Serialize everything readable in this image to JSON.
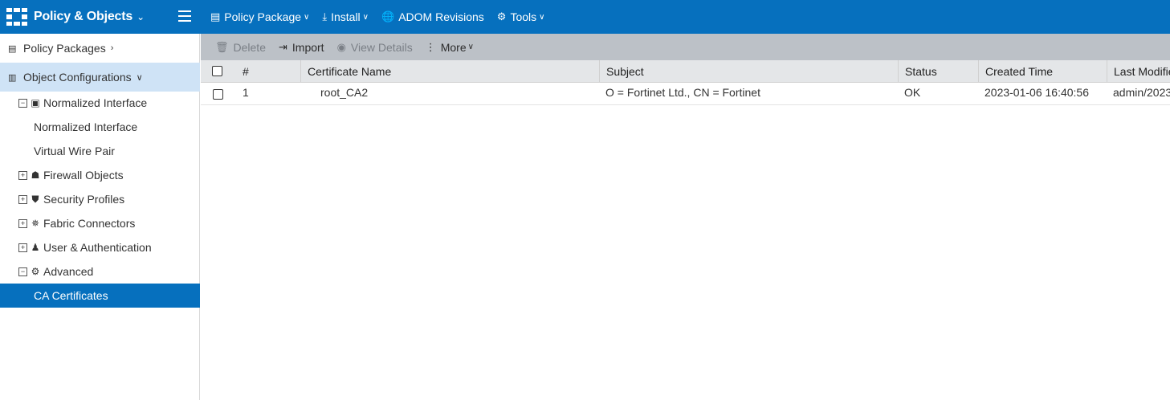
{
  "topbar": {
    "app_title": "Policy & Objects",
    "menu": [
      {
        "label": "Policy Package",
        "icon": "policy-package-icon"
      },
      {
        "label": "Install",
        "icon": "install-icon"
      },
      {
        "label": "ADOM Revisions",
        "icon": "globe-icon"
      },
      {
        "label": "Tools",
        "icon": "gear-icon"
      }
    ],
    "colors": {
      "accent": "#0670be"
    }
  },
  "sidebar": {
    "policy_packages": "Policy Packages",
    "object_configurations": "Object Configurations",
    "items": [
      {
        "label": "Normalized Interface",
        "icon": "interface-icon",
        "expander": "−"
      },
      {
        "label": "Normalized Interface"
      },
      {
        "label": "Virtual Wire Pair"
      },
      {
        "label": "Firewall Objects",
        "icon": "firewall-icon",
        "expander": "+"
      },
      {
        "label": "Security Profiles",
        "icon": "shield-icon",
        "expander": "+"
      },
      {
        "label": "Fabric Connectors",
        "icon": "connector-icon",
        "expander": "+"
      },
      {
        "label": "User & Authentication",
        "icon": "user-icon",
        "expander": "+"
      },
      {
        "label": "Advanced",
        "icon": "advanced-icon",
        "expander": "−"
      },
      {
        "label": "CA Certificates",
        "selected": true
      }
    ]
  },
  "toolbar": {
    "delete": "Delete",
    "import": "Import",
    "view_details": "View Details",
    "more": "More"
  },
  "table": {
    "columns": [
      "#",
      "Certificate Name",
      "Subject",
      "Status",
      "Created Time",
      "Last Modified"
    ],
    "rows": [
      {
        "num": "1",
        "name": "root_CA2",
        "subject": "O = Fortinet Ltd., CN = Fortinet",
        "status": "OK",
        "created": "2023-01-06 16:40:56",
        "modified": "admin/2023"
      }
    ]
  }
}
